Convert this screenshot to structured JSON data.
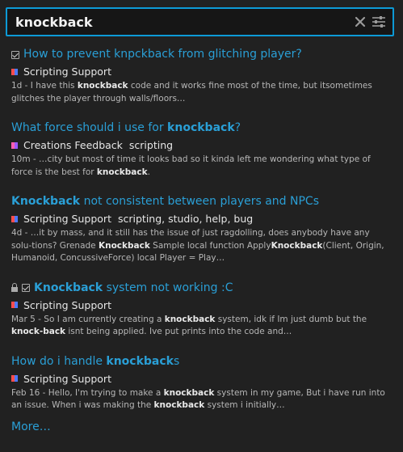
{
  "search": {
    "value": "knockback",
    "placeholder": ""
  },
  "icons": {
    "clear": "close-icon",
    "filter": "sliders-icon"
  },
  "colors": {
    "accent": "#0d9ad6",
    "link": "#2a9fd6",
    "background": "#212121"
  },
  "results": [
    {
      "title_pre": "How to prevent knpckback from glitching player?",
      "title_hl": "",
      "title_post": "",
      "solved": true,
      "locked": false,
      "category": "Scripting Support",
      "tags": "",
      "excerpt_parts": [
        "1d - I have this ",
        "knockback",
        " code and it works fine most of the time, but itsometimes glitches the player through walls/floors…"
      ]
    },
    {
      "title_pre": "What force should i use for ",
      "title_hl": "knockback",
      "title_post": "?",
      "solved": false,
      "locked": false,
      "category": "Creations Feedback",
      "tags": "scripting",
      "excerpt_parts": [
        "10m - …city but most of time it looks bad so it kinda left me wondering what type of force is the best for ",
        "knockback",
        "."
      ]
    },
    {
      "title_pre": "",
      "title_hl": "Knockback",
      "title_post": " not consistent between players and NPCs",
      "solved": false,
      "locked": false,
      "category": "Scripting Support",
      "tags": "scripting, studio, help, bug",
      "excerpt_parts": [
        "4d - …it by mass, and it still has the issue of just ragdolling, does anybody have any solu-tions? Grenade ",
        "Knockback",
        " Sample local function Apply",
        "Knockback",
        "(Client, Origin, Humanoid, ConcussiveForce) local Player = Play…"
      ]
    },
    {
      "title_pre": "",
      "title_hl": "Knockback",
      "title_post": " system not working :C",
      "solved": true,
      "locked": true,
      "category": "Scripting Support",
      "tags": "",
      "excerpt_parts": [
        "Mar 5 - So I am currently creating a ",
        "knockback",
        " system, idk if Im just dumb but the ",
        "knock-back",
        " isnt being applied. Ive put prints into the code and…"
      ]
    },
    {
      "title_pre": "How do i handle ",
      "title_hl": "knockback",
      "title_post": "s",
      "solved": false,
      "locked": false,
      "category": "Scripting Support",
      "tags": "",
      "excerpt_parts": [
        "Feb 16 - Hello, I'm trying to make a ",
        "knockback",
        " system in my game, But i have run into an issue. When i was making the ",
        "knockback",
        " system i initially…"
      ]
    }
  ],
  "more_label": "More…"
}
